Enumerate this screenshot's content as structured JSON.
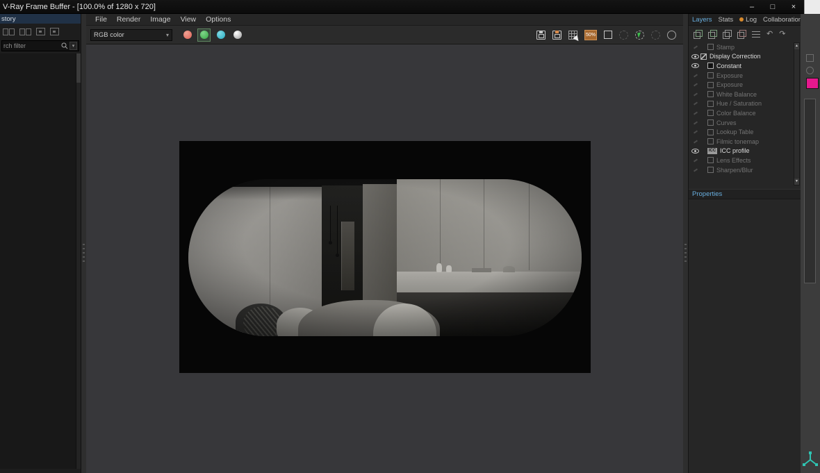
{
  "window": {
    "title": "V-Ray Frame Buffer - [100.0% of 1280 x 720]",
    "controls": {
      "minimize": "–",
      "maximize": "□",
      "close": "×"
    }
  },
  "history_panel": {
    "header": "story",
    "search_text": "rch filter"
  },
  "menu_bar": {
    "items": [
      "File",
      "Render",
      "Image",
      "View",
      "Options"
    ]
  },
  "main_toolbar": {
    "channel_dropdown": "RGB color",
    "zoom_badge": "50%"
  },
  "right_panel": {
    "tabs": [
      {
        "label": "Layers",
        "active": true
      },
      {
        "label": "Stats"
      },
      {
        "label": "Log",
        "dot": true
      },
      {
        "label": "Collaboration"
      }
    ],
    "layers": [
      {
        "name": "Stamp",
        "state": "dim",
        "eye": false,
        "icon": "plain",
        "indent": 1
      },
      {
        "name": "Display Correction",
        "state": "bright",
        "eye": true,
        "icon": "diag",
        "indent": 0
      },
      {
        "name": "Constant",
        "state": "bright",
        "eye": true,
        "icon": "solid",
        "indent": 1
      },
      {
        "name": "Exposure",
        "state": "dim",
        "eye": false,
        "icon": "plain",
        "indent": 1
      },
      {
        "name": "Exposure",
        "state": "dim",
        "eye": false,
        "icon": "plain",
        "indent": 1
      },
      {
        "name": "White Balance",
        "state": "dim",
        "eye": false,
        "icon": "plain",
        "indent": 1
      },
      {
        "name": "Hue / Saturation",
        "state": "dim",
        "eye": false,
        "icon": "plain",
        "indent": 1
      },
      {
        "name": "Color Balance",
        "state": "dim",
        "eye": false,
        "icon": "plain",
        "indent": 1
      },
      {
        "name": "Curves",
        "state": "dim",
        "eye": false,
        "icon": "plain",
        "indent": 1
      },
      {
        "name": "Lookup Table",
        "state": "dim",
        "eye": false,
        "icon": "plain",
        "indent": 1
      },
      {
        "name": "Filmic tonemap",
        "state": "dim",
        "eye": false,
        "icon": "plain",
        "indent": 1
      },
      {
        "name": "ICC profile",
        "state": "bright",
        "eye": true,
        "icon": "icc",
        "badge": "ICC",
        "indent": 1
      },
      {
        "name": "Lens Effects",
        "state": "dim",
        "eye": false,
        "icon": "plain",
        "indent": 1
      },
      {
        "name": "Sharpen/Blur",
        "state": "dim",
        "eye": false,
        "icon": "plain",
        "indent": 1
      }
    ],
    "properties_label": "Properties"
  },
  "icons": {
    "dropdown_arrow": "▾",
    "undo": "↶",
    "redo": "↷",
    "scroll_up": "▲",
    "scroll_down": "▼"
  },
  "colors": {
    "accent_blue": "#68aede",
    "log_dot_orange": "#d88a2c",
    "zoom_badge_orange": "#a8692f",
    "channel_red": "#e2695c",
    "channel_green": "#3db04b",
    "channel_blue": "#2fb4c8",
    "swatch_magenta": "#e5188e",
    "gizmo_teal": "#2fc4b2",
    "cursor_green": "#3fc24f"
  }
}
